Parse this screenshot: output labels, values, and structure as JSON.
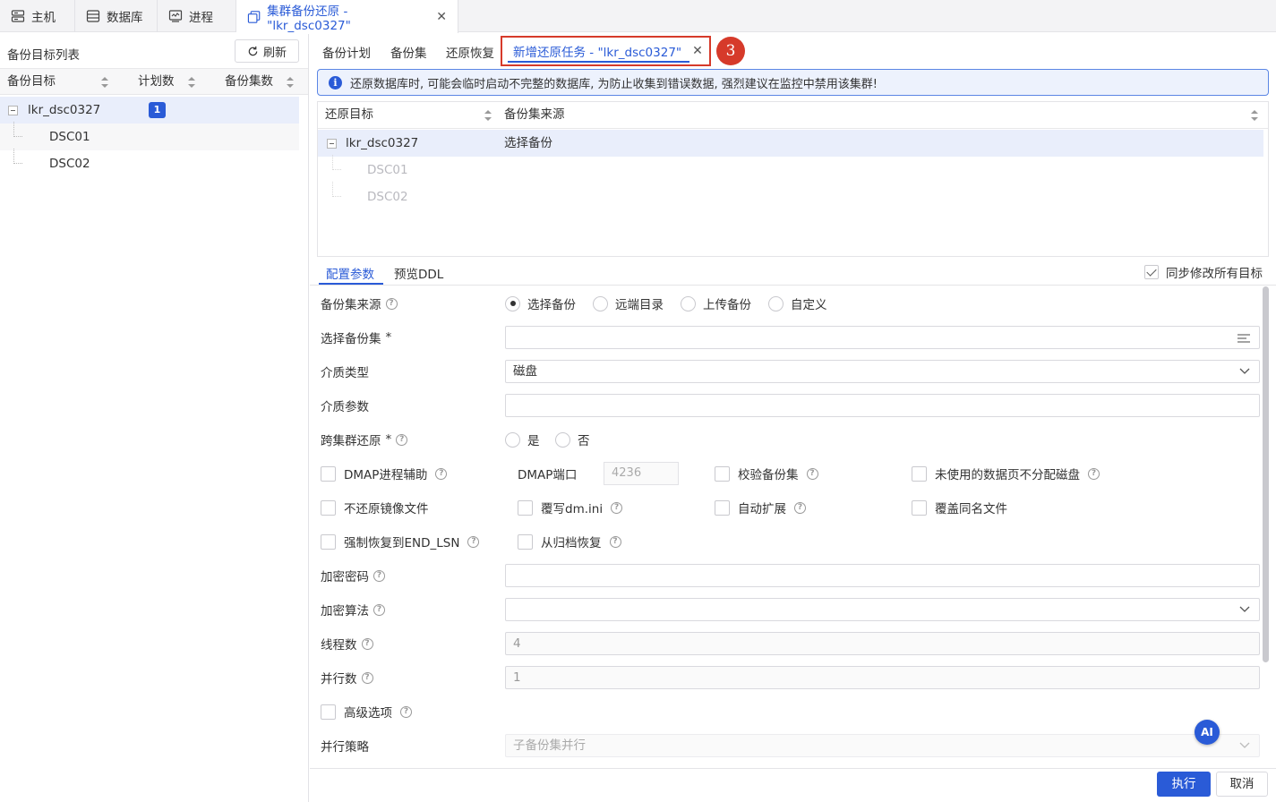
{
  "top_tabs": [
    {
      "label": "主机",
      "icon": "server-icon"
    },
    {
      "label": "数据库",
      "icon": "database-icon"
    },
    {
      "label": "进程",
      "icon": "process-icon"
    },
    {
      "label": "集群备份还原 - \"lkr_dsc0327\"",
      "icon": "copy-icon",
      "active": true
    }
  ],
  "left_panel": {
    "title": "备份目标列表",
    "refresh_label": "刷新",
    "columns": [
      "备份目标",
      "计划数",
      "备份集数"
    ],
    "rows": [
      {
        "name": "lkr_dsc0327",
        "plans": "1"
      },
      {
        "name": "DSC01"
      },
      {
        "name": "DSC02"
      }
    ]
  },
  "sub_tabs": [
    "备份计划",
    "备份集",
    "还原恢复"
  ],
  "active_sub_tab": "新增还原任务 - \"lkr_dsc0327\"",
  "step_marker": "3",
  "alert_text": "还原数据库时, 可能会临时启动不完整的数据库, 为防止收集到错误数据, 强烈建议在监控中禁用该集群!",
  "restore_table": {
    "columns": [
      "还原目标",
      "备份集来源"
    ],
    "rows": [
      {
        "target": "lkr_dsc0327",
        "source": "选择备份"
      },
      {
        "target": "DSC01",
        "source": ""
      },
      {
        "target": "DSC02",
        "source": ""
      }
    ]
  },
  "config_tabs": [
    "配置参数",
    "预览DDL"
  ],
  "sync_label": "同步修改所有目标",
  "form": {
    "backup_source_label": "备份集来源",
    "backup_source_options": [
      "选择备份",
      "远端目录",
      "上传备份",
      "自定义"
    ],
    "select_backup_label": "选择备份集",
    "media_type_label": "介质类型",
    "media_type_value": "磁盘",
    "media_param_label": "介质参数",
    "cross_cluster_label": "跨集群还原",
    "cross_cluster_options": [
      "是",
      "否"
    ],
    "dmap_assist_label": "DMAP进程辅助",
    "dmap_port_label": "DMAP端口",
    "dmap_port_value": "4236",
    "verify_backup_label": "校验备份集",
    "unused_pages_label": "未使用的数据页不分配磁盘",
    "no_restore_mirror_label": "不还原镜像文件",
    "overwrite_dmini_label": "覆写dm.ini",
    "auto_extend_label": "自动扩展",
    "overwrite_same_label": "覆盖同名文件",
    "force_end_lsn_label": "强制恢复到END_LSN",
    "from_archive_label": "从归档恢复",
    "encrypt_pwd_label": "加密密码",
    "encrypt_algo_label": "加密算法",
    "threads_label": "线程数",
    "threads_value": "4",
    "parallel_label": "并行数",
    "parallel_value": "1",
    "advanced_label": "高级选项",
    "parallel_strategy_label": "并行策略",
    "parallel_strategy_value": "子备份集并行"
  },
  "ai_label": "AI",
  "footer": {
    "execute_label": "执行",
    "cancel_label": "取消"
  },
  "colors": {
    "accent": "#2a5bd7",
    "highlight": "#d63a2a"
  }
}
